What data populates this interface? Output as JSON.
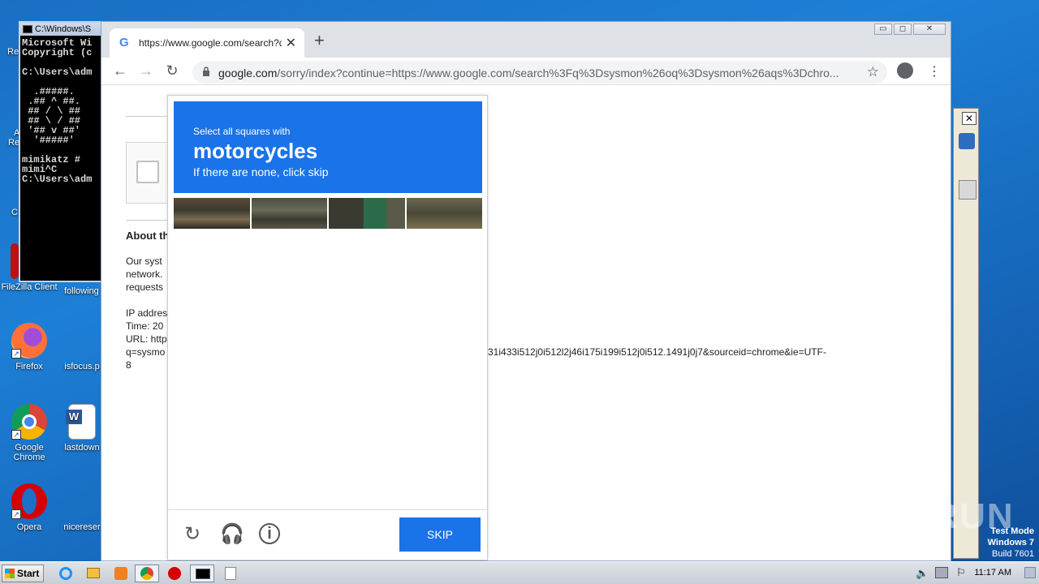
{
  "desktop": {
    "icons": [
      {
        "label": "FileZilla Client"
      },
      {
        "label": "following"
      },
      {
        "label": "Firefox"
      },
      {
        "label": "isfocus.p"
      },
      {
        "label": "Google Chrome"
      },
      {
        "label": "lastdown"
      },
      {
        "label": "Opera"
      },
      {
        "label": "nicereser"
      }
    ],
    "partial_labels": [
      "Re",
      "A",
      "Re",
      "C"
    ]
  },
  "cmd": {
    "title": "C:\\Windows\\S",
    "content": "Microsoft Wi\nCopyright (c\n\nC:\\Users\\adm\n\n  .#####.\n .## ^ ##.\n ## / \\ ##\n ## \\ / ##\n '## v ##'\n  '#####'\n\nmimikatz #\nmimi^C\nC:\\Users\\adm"
  },
  "browser": {
    "tab_title": "https://www.google.com/search?q=",
    "tab_close": "✕",
    "new_tab": "+",
    "window_controls": [
      "▭",
      "◻",
      "✕"
    ],
    "url_host": "google.com",
    "url_rest": "/sorry/index?continue=https://www.google.com/search%3Fq%3Dsysmon%26oq%3Dsysmon%26aqs%3Dchro...",
    "page": {
      "about": "About th",
      "line1": "Our syst",
      "line2": "network.",
      "line3": "requests",
      "ip": "IP addres",
      "time": "Time: 20",
      "url": "URL: http",
      "q": "q=sysmo",
      "tail": "31i433i512j0i512l2j46i175i199i512j0i512.1491j0j7&sourceid=chrome&ie=UTF-",
      "tail2": "8"
    }
  },
  "captcha": {
    "instruction": "Select all squares with",
    "target": "motorcycles",
    "hint": "If there are none, click skip",
    "skip_label": "SKIP"
  },
  "taskbar": {
    "start_label": "Start",
    "clock": "11:17 AM"
  },
  "watermark": "ANY RUN",
  "testmode": {
    "line1": "Test Mode",
    "line2": "Windows 7",
    "line3": "Build 7601"
  }
}
